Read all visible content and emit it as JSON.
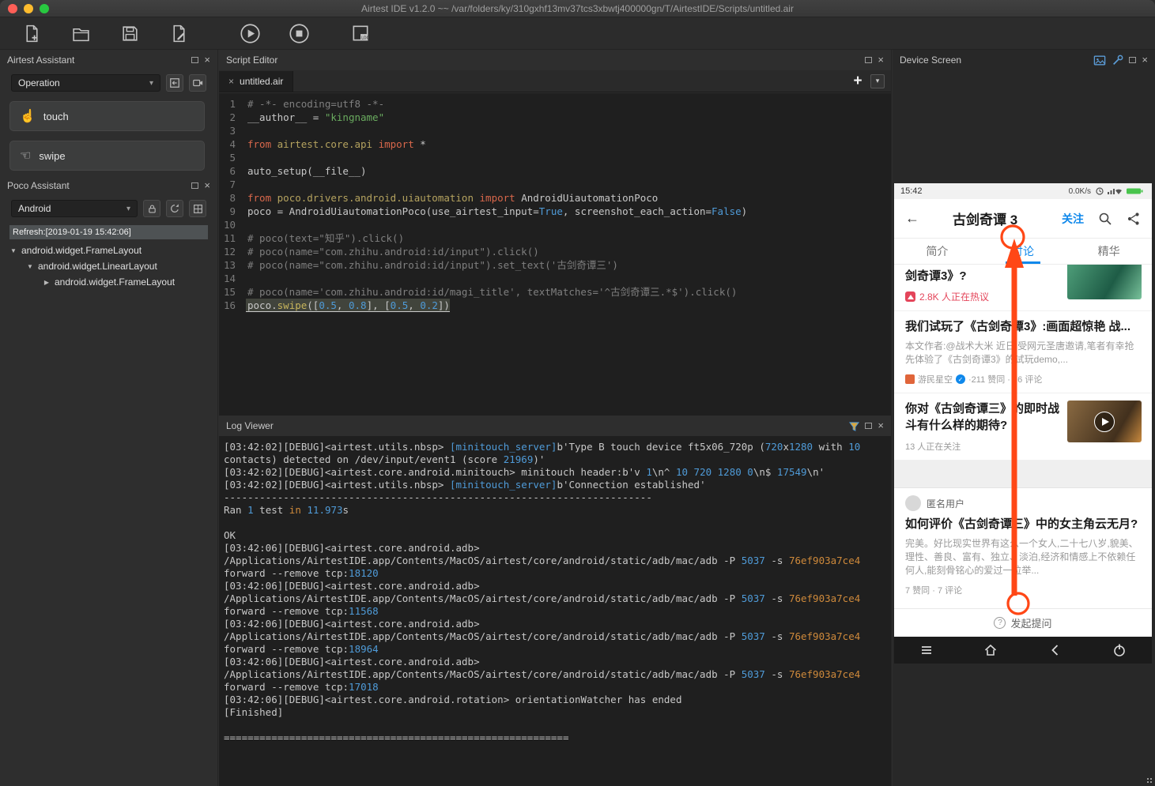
{
  "window": {
    "title": "Airtest IDE v1.2.0 ~~ /var/folders/ky/310gxhf13mv37tcs3xbwtj400000gn/T/AirtestIDE/Scripts/untitled.air"
  },
  "icons": {
    "close": "×",
    "caret": "▾",
    "plus": "+",
    "back": "←",
    "check": "✓",
    "tree_open": "▼",
    "tree_closed": "▶",
    "touch_glyph": "☝",
    "swipe_glyph": "☜",
    "question": "?"
  },
  "airtest_assistant": {
    "title": "Airtest Assistant",
    "mode_dropdown": "Operation",
    "actions": [
      {
        "label": "touch"
      },
      {
        "label": "swipe"
      }
    ]
  },
  "poco_assistant": {
    "title": "Poco Assistant",
    "mode_dropdown": "Android",
    "refresh_text": "Refresh:[2019-01-19 15:42:06]",
    "tree": [
      {
        "label": "android.widget.FrameLayout",
        "level": 0,
        "state": "expanded"
      },
      {
        "label": "android.widget.LinearLayout",
        "level": 1,
        "state": "expanded"
      },
      {
        "label": "android.widget.FrameLayout",
        "level": 2,
        "state": "collapsed"
      }
    ]
  },
  "script_editor": {
    "title": "Script Editor",
    "tab": "untitled.air",
    "code": [
      {
        "seg": [
          {
            "t": "# -*- encoding=utf8 -*-",
            "c": "com"
          }
        ]
      },
      {
        "seg": [
          {
            "t": "__author__ = ",
            "c": "pln"
          },
          {
            "t": "\"kingname\"",
            "c": "str"
          }
        ]
      },
      {
        "seg": []
      },
      {
        "seg": [
          {
            "t": "from ",
            "c": "kw"
          },
          {
            "t": "airtest.core.api ",
            "c": "mod"
          },
          {
            "t": "import ",
            "c": "kw"
          },
          {
            "t": "*",
            "c": "pln"
          }
        ]
      },
      {
        "seg": []
      },
      {
        "seg": [
          {
            "t": "auto_setup(__file__)",
            "c": "pln"
          }
        ]
      },
      {
        "seg": []
      },
      {
        "seg": [
          {
            "t": "from ",
            "c": "kw"
          },
          {
            "t": "poco.drivers.android.uiautomation ",
            "c": "mod"
          },
          {
            "t": "import ",
            "c": "kw"
          },
          {
            "t": "AndroidUiautomationPoco",
            "c": "pln"
          }
        ]
      },
      {
        "seg": [
          {
            "t": "poco = AndroidUiautomationPoco(use_airtest_input=",
            "c": "pln"
          },
          {
            "t": "True",
            "c": "num"
          },
          {
            "t": ", screenshot_each_action=",
            "c": "pln"
          },
          {
            "t": "False",
            "c": "num"
          },
          {
            "t": ")",
            "c": "pln"
          }
        ]
      },
      {
        "seg": []
      },
      {
        "seg": [
          {
            "t": "# poco(text=\"知乎\").click()",
            "c": "com"
          }
        ]
      },
      {
        "seg": [
          {
            "t": "# poco(name=\"com.zhihu.android:id/input\").click()",
            "c": "com"
          }
        ]
      },
      {
        "seg": [
          {
            "t": "# poco(name=\"com.zhihu.android:id/input\").set_text('古剑奇谭三')",
            "c": "com"
          }
        ]
      },
      {
        "seg": []
      },
      {
        "seg": [
          {
            "t": "# poco(name='com.zhihu.android:id/magi_title', textMatches='^古剑奇谭三.*$').click()",
            "c": "com"
          }
        ]
      },
      {
        "seg": [
          {
            "t": "poco.",
            "c": "pln"
          },
          {
            "t": "swipe",
            "c": "fn"
          },
          {
            "t": "([",
            "c": "pln"
          },
          {
            "t": "0.5",
            "c": "num"
          },
          {
            "t": ", ",
            "c": "pln"
          },
          {
            "t": "0.8",
            "c": "num"
          },
          {
            "t": "], [",
            "c": "pln"
          },
          {
            "t": "0.5",
            "c": "num"
          },
          {
            "t": ", ",
            "c": "pln"
          },
          {
            "t": "0.2",
            "c": "num"
          },
          {
            "t": "])",
            "c": "pln"
          }
        ],
        "cur": true
      }
    ]
  },
  "log_viewer": {
    "title": "Log Viewer",
    "lines": [
      [
        {
          "t": "[03:42:02][DEBUG]<airtest.utils.nbsp> ",
          "c": "pln"
        },
        {
          "t": "[minitouch_server]",
          "c": "blu"
        },
        {
          "t": "b'Type B touch device ft5x06_720p (",
          "c": "pln"
        },
        {
          "t": "720",
          "c": "num"
        },
        {
          "t": "x",
          "c": "pln"
        },
        {
          "t": "1280",
          "c": "num"
        },
        {
          "t": " with ",
          "c": "pln"
        },
        {
          "t": "10",
          "c": "num"
        }
      ],
      [
        {
          "t": "contacts) detected on /dev/input/event1 (score ",
          "c": "pln"
        },
        {
          "t": "21969",
          "c": "num"
        },
        {
          "t": ")'",
          "c": "pln"
        }
      ],
      [
        {
          "t": "[03:42:02][DEBUG]<airtest.core.android.minitouch> minitouch header:b'v ",
          "c": "pln"
        },
        {
          "t": "1",
          "c": "num"
        },
        {
          "t": "\\n^ ",
          "c": "pln"
        },
        {
          "t": "10 720 1280 0",
          "c": "num"
        },
        {
          "t": "\\n$ ",
          "c": "pln"
        },
        {
          "t": "17549",
          "c": "num"
        },
        {
          "t": "\\n'",
          "c": "pln"
        }
      ],
      [
        {
          "t": "[03:42:02][DEBUG]<airtest.utils.nbsp> ",
          "c": "pln"
        },
        {
          "t": "[minitouch_server]",
          "c": "blu"
        },
        {
          "t": "b'Connection established'",
          "c": "pln"
        }
      ],
      [
        {
          "t": "------------------------------------------------------------------------",
          "c": "pln"
        }
      ],
      [
        {
          "t": "Ran ",
          "c": "pln"
        },
        {
          "t": "1",
          "c": "num"
        },
        {
          "t": " test ",
          "c": "pln"
        },
        {
          "t": "in",
          "c": "org"
        },
        {
          "t": " ",
          "c": "pln"
        },
        {
          "t": "11.973",
          "c": "num"
        },
        {
          "t": "s",
          "c": "pln"
        }
      ],
      [],
      [
        {
          "t": "OK",
          "c": "pln"
        }
      ],
      [
        {
          "t": "[03:42:06][DEBUG]<airtest.core.android.adb>",
          "c": "pln"
        }
      ],
      [
        {
          "t": "/Applications/AirtestIDE.app/Contents/MacOS/airtest/core/android/static/adb/mac/adb -P ",
          "c": "pln"
        },
        {
          "t": "5037",
          "c": "num"
        },
        {
          "t": " -s ",
          "c": "pln"
        },
        {
          "t": "76ef903a7ce4",
          "c": "org"
        }
      ],
      [
        {
          "t": "forward --remove tcp:",
          "c": "pln"
        },
        {
          "t": "18120",
          "c": "num"
        }
      ],
      [
        {
          "t": "[03:42:06][DEBUG]<airtest.core.android.adb>",
          "c": "pln"
        }
      ],
      [
        {
          "t": "/Applications/AirtestIDE.app/Contents/MacOS/airtest/core/android/static/adb/mac/adb -P ",
          "c": "pln"
        },
        {
          "t": "5037",
          "c": "num"
        },
        {
          "t": " -s ",
          "c": "pln"
        },
        {
          "t": "76ef903a7ce4",
          "c": "org"
        }
      ],
      [
        {
          "t": "forward --remove tcp:",
          "c": "pln"
        },
        {
          "t": "11568",
          "c": "num"
        }
      ],
      [
        {
          "t": "[03:42:06][DEBUG]<airtest.core.android.adb>",
          "c": "pln"
        }
      ],
      [
        {
          "t": "/Applications/AirtestIDE.app/Contents/MacOS/airtest/core/android/static/adb/mac/adb -P ",
          "c": "pln"
        },
        {
          "t": "5037",
          "c": "num"
        },
        {
          "t": " -s ",
          "c": "pln"
        },
        {
          "t": "76ef903a7ce4",
          "c": "org"
        }
      ],
      [
        {
          "t": "forward --remove tcp:",
          "c": "pln"
        },
        {
          "t": "18964",
          "c": "num"
        }
      ],
      [
        {
          "t": "[03:42:06][DEBUG]<airtest.core.android.adb>",
          "c": "pln"
        }
      ],
      [
        {
          "t": "/Applications/AirtestIDE.app/Contents/MacOS/airtest/core/android/static/adb/mac/adb -P ",
          "c": "pln"
        },
        {
          "t": "5037",
          "c": "num"
        },
        {
          "t": " -s ",
          "c": "pln"
        },
        {
          "t": "76ef903a7ce4",
          "c": "org"
        }
      ],
      [
        {
          "t": "forward --remove tcp:",
          "c": "pln"
        },
        {
          "t": "17018",
          "c": "num"
        }
      ],
      [
        {
          "t": "[03:42:06][DEBUG]<airtest.core.android.rotation> orientationWatcher has ended",
          "c": "pln"
        }
      ],
      [
        {
          "t": "[Finished]",
          "c": "pln"
        }
      ],
      [],
      [
        {
          "t": "==========================================================",
          "c": "pln"
        }
      ]
    ]
  },
  "device_screen": {
    "title": "Device Screen",
    "phone": {
      "status": {
        "time": "15:42",
        "net": "0.0K/s"
      },
      "appbar": {
        "title": "古剑奇谭 3",
        "follow": "关注"
      },
      "tabs": {
        "t1": "简介",
        "t2": "讨论",
        "t3": "精华"
      },
      "card1": {
        "title": "剑奇谭3》?",
        "hot": "2.8K 人正在热议"
      },
      "card2": {
        "title": "我们试玩了《古剑奇谭3》:画面超惊艳 战...",
        "body": "本文作者:@战术大米 近日,受网元圣唐邀请,笔者有幸抢先体验了《古剑奇谭3》的试玩demo,...",
        "source": "游民星空",
        "meta": "·211 赞同 · 76 评论"
      },
      "card3": {
        "title": "你对《古剑奇谭三》的即时战斗有什么样的期待?",
        "meta": "13 人正在关注"
      },
      "card4": {
        "user": "匿名用户",
        "title": "如何评价《古剑奇谭三》中的女主角云无月?",
        "body": "完美。好比现实世界有这么一个女人,二十七八岁,貌美、理性、善良、富有、独立、淡泊,经济和情感上不依赖任何人,能刻骨铭心的爱过一位举...",
        "meta": "7 赞同 · 7 评论"
      },
      "ask": "发起提问"
    }
  }
}
